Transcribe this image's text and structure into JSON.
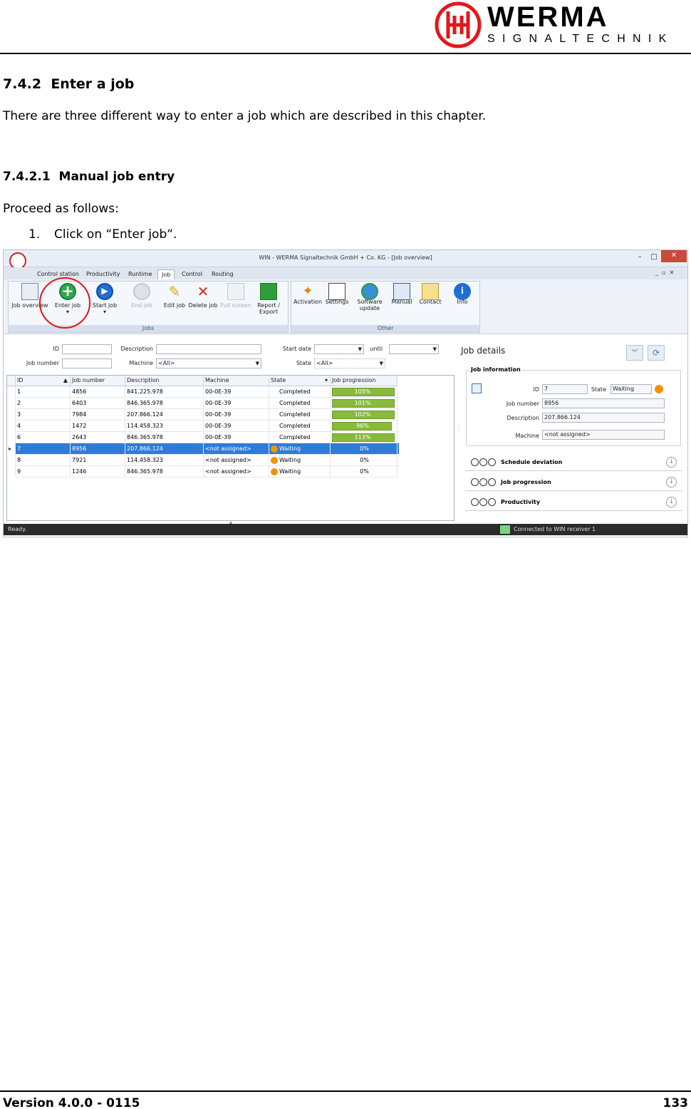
{
  "header": {
    "logo_word": "WERMA",
    "logo_sub": "SIGNALTECHNIK"
  },
  "section": {
    "title": "7.4.2  Enter a job",
    "intro": "There are three different way to enter a job which are described in this chapter."
  },
  "subsection": {
    "title": "7.4.2.1  Manual job entry",
    "lead": "Proceed as follows:",
    "step_number": "1.",
    "step_text": "Click on “Enter job“."
  },
  "app": {
    "title": "WIN - WERMA Signaltechnik GmbH + Co. KG - [Job overview]",
    "tabs": [
      "Control station",
      "Productivity",
      "Runtime",
      "Job",
      "Control",
      "Routing"
    ],
    "active_tab": "Job",
    "ribbon": {
      "jobs_group": "Jobs",
      "other_group": "Other",
      "buttons": {
        "job_overview": "Job overview",
        "enter_job": "Enter job",
        "start_job": "Start job",
        "end_job": "End job",
        "edit_job": "Edit job",
        "delete_job": "Delete job",
        "full_screen": "Full screen",
        "report_export_1": "Report /",
        "report_export_2": "Export",
        "activation": "Activation",
        "settings": "Settings",
        "software_update_1": "Software",
        "software_update_2": "update",
        "manual": "Manual",
        "contact": "Contact",
        "info": "Info"
      }
    },
    "filters": {
      "id": "ID",
      "job_number": "Job number",
      "description": "Description",
      "machine": "Machine",
      "machine_value": "<All>",
      "start_date": "Start date",
      "until": "until",
      "state": "State",
      "state_value": "<All>"
    },
    "grid": {
      "columns": [
        "ID",
        "Job number",
        "Description",
        "Machine",
        "State",
        "Job progression"
      ],
      "rows": [
        {
          "id": "1",
          "num": "4856",
          "desc": "841.225.978",
          "machine": "00-0E-39",
          "state": "Completed",
          "prog": "105%",
          "fill": 1.0
        },
        {
          "id": "2",
          "num": "6403",
          "desc": "846.365.978",
          "machine": "00-0E-39",
          "state": "Completed",
          "prog": "101%",
          "fill": 1.0
        },
        {
          "id": "3",
          "num": "7984",
          "desc": "207.866.124",
          "machine": "00-0E-39",
          "state": "Completed",
          "prog": "102%",
          "fill": 1.0
        },
        {
          "id": "4",
          "num": "1472",
          "desc": "114.458.323",
          "machine": "00-0E-39",
          "state": "Completed",
          "prog": "96%",
          "fill": 0.96
        },
        {
          "id": "6",
          "num": "2643",
          "desc": "846.365.978",
          "machine": "00-0E-39",
          "state": "Completed",
          "prog": "113%",
          "fill": 1.0
        },
        {
          "id": "7",
          "num": "8956",
          "desc": "207.866.124",
          "machine": "<not assigned>",
          "state": "Waiting",
          "prog": "0%",
          "fill": 0
        },
        {
          "id": "8",
          "num": "7921",
          "desc": "114.458.323",
          "machine": "<not assigned>",
          "state": "Waiting",
          "prog": "0%",
          "fill": 0
        },
        {
          "id": "9",
          "num": "1246",
          "desc": "846.365.978",
          "machine": "<not assigned>",
          "state": "Waiting",
          "prog": "0%",
          "fill": 0
        }
      ]
    },
    "details": {
      "title": "Job details",
      "info_heading": "Job information",
      "id_label": "ID",
      "id_value": "7",
      "state_label": "State",
      "state_value": "Waiting",
      "job_number_label": "Job number",
      "job_number_value": "8956",
      "description_label": "Description",
      "description_value": "207.866.124",
      "machine_label": "Machine",
      "machine_value": "<not assigned>",
      "sections": [
        "Schedule deviation",
        "Job progression",
        "Productivity"
      ]
    },
    "status": {
      "left": "Ready.",
      "right": "Connected to WIN receiver 1"
    },
    "colors": {
      "accent": "#2d7cd8",
      "progress": "#8aba3c",
      "waiting": "#f39200",
      "highlight": "#e4161a"
    }
  },
  "footer": {
    "version": "Version 4.0.0 - 0115",
    "page": "133"
  }
}
